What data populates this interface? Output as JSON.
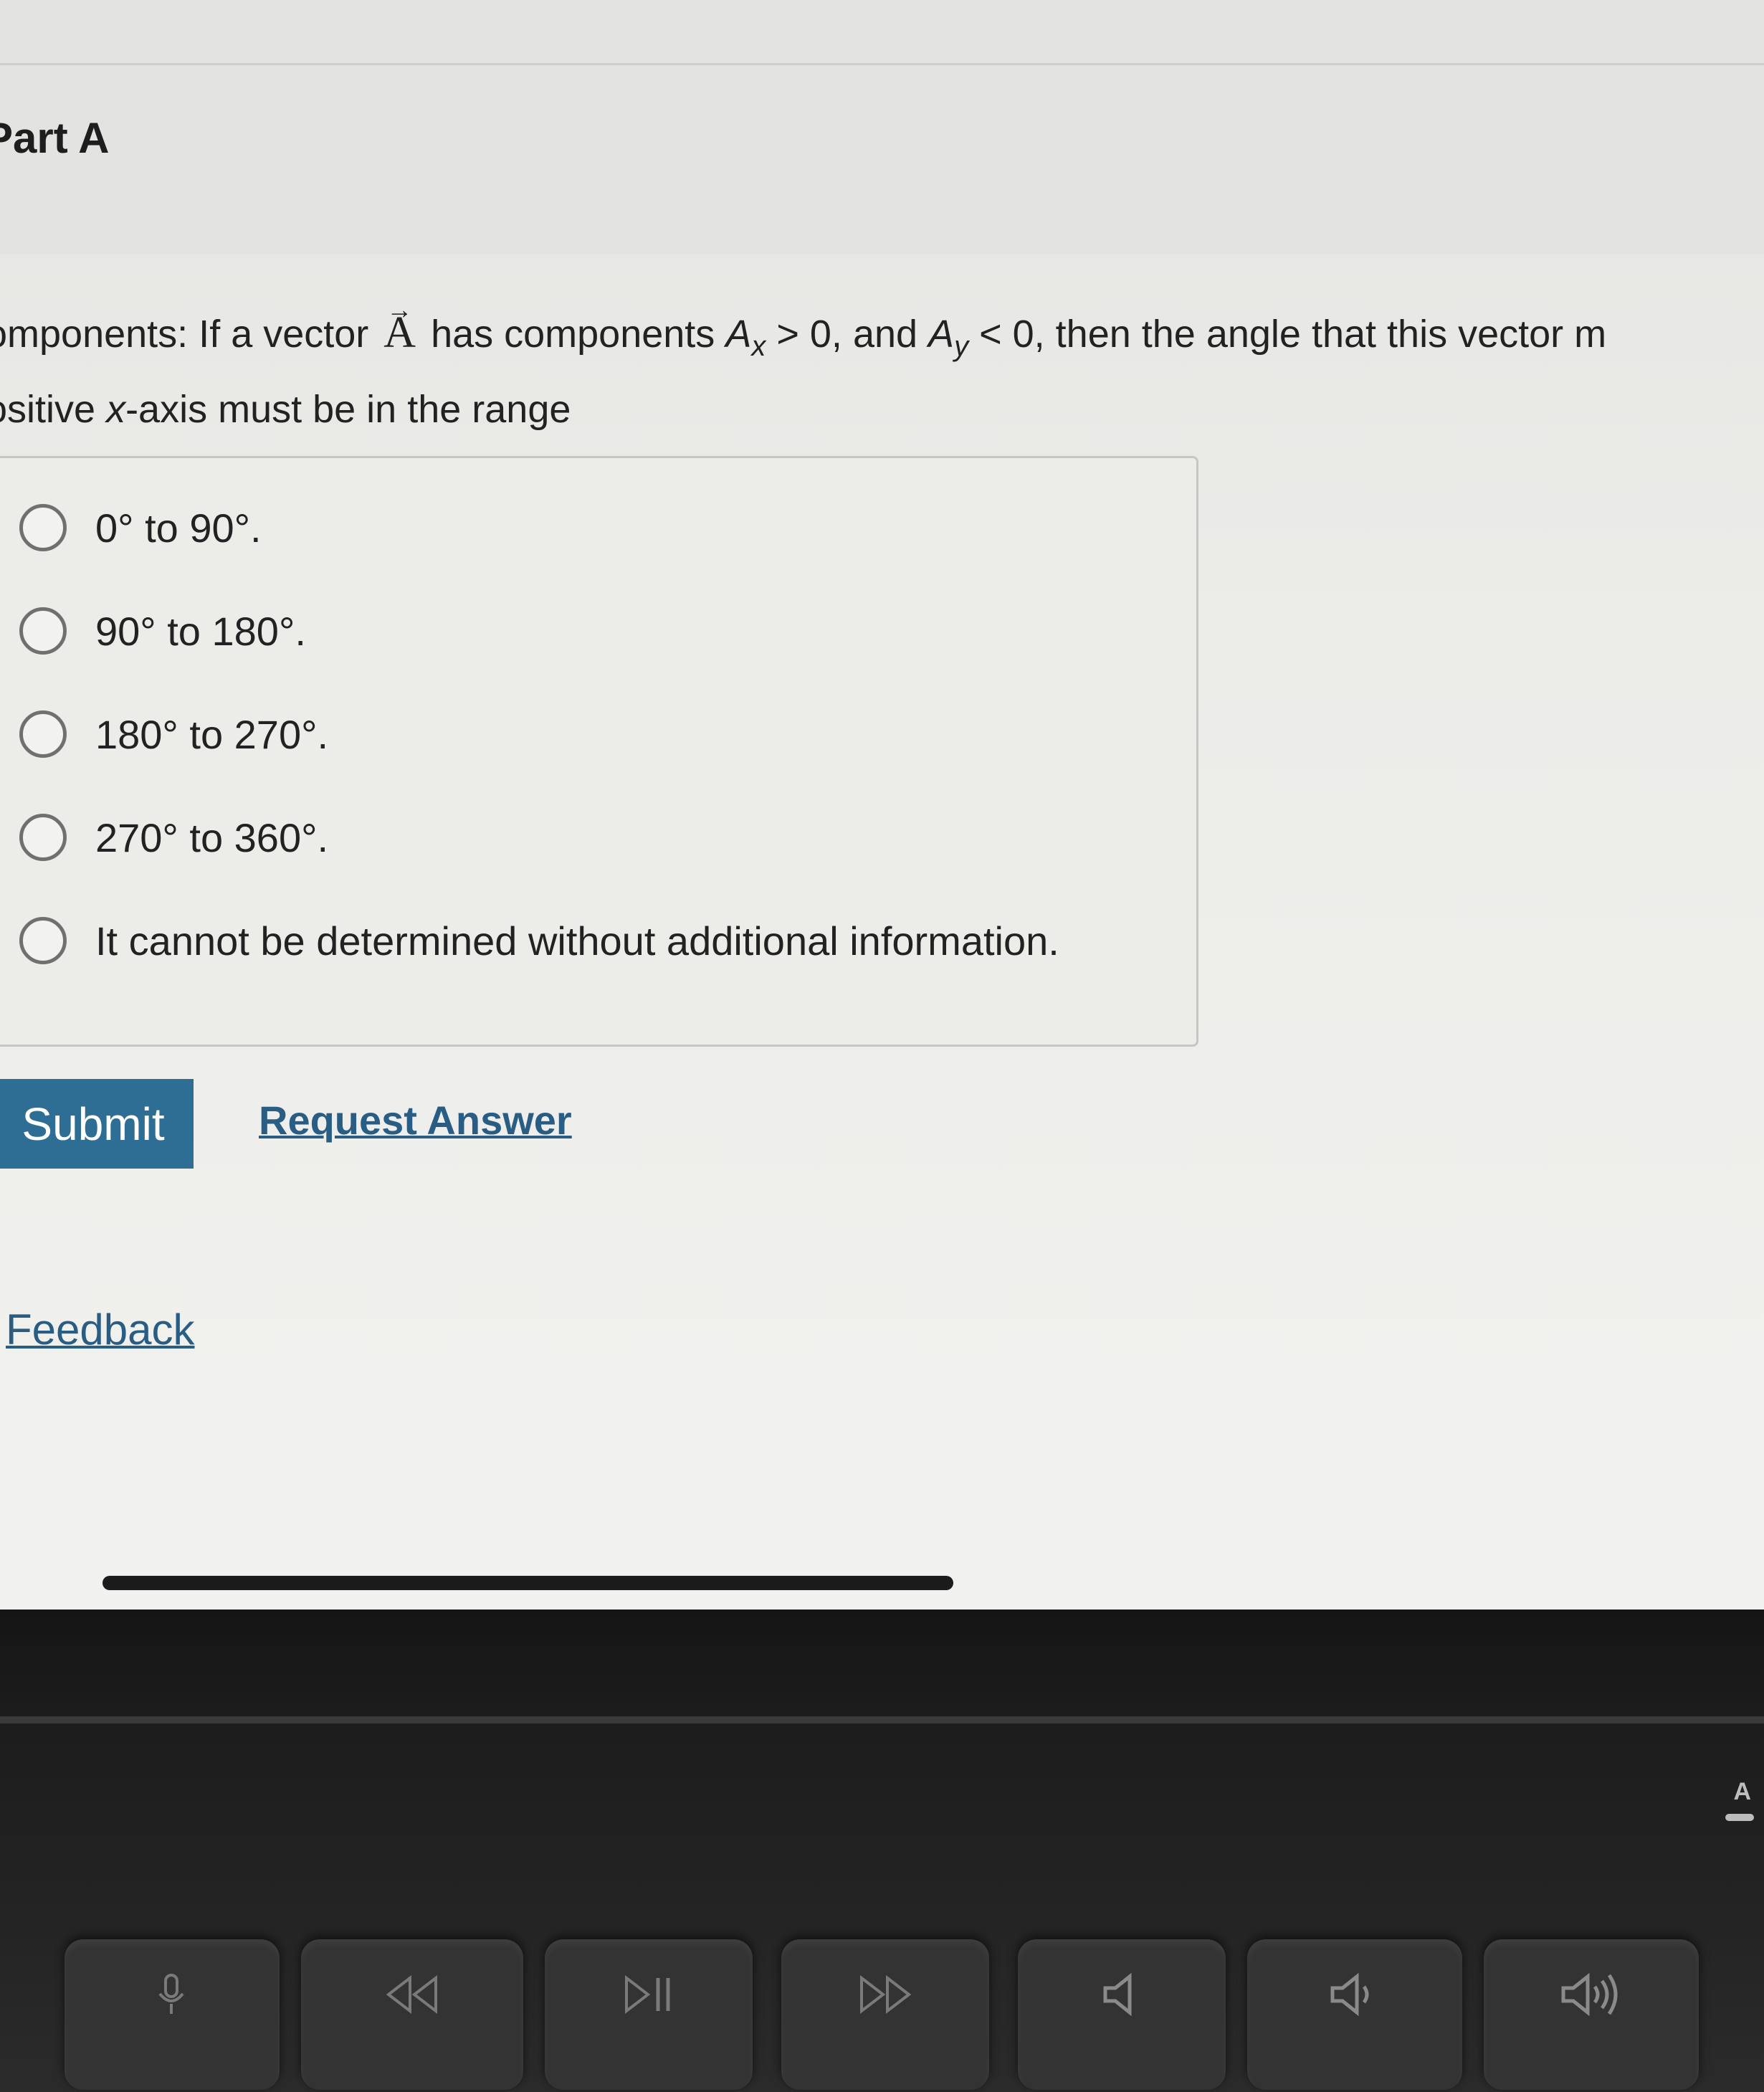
{
  "part": {
    "title": "Part A"
  },
  "question": {
    "line1": {
      "lead": "omponents: If a vector ",
      "vector": "A",
      "mid": " has components ",
      "ax": "A",
      "ax_sub": "x",
      "ax_rest": " > 0, and ",
      "ay": "A",
      "ay_sub": "y",
      "ay_rest": " < 0, then the angle that this vector m"
    },
    "line2": {
      "lead": "ositive ",
      "x": "x",
      "rest": "-axis must be in the range"
    }
  },
  "options": [
    {
      "label": "0° to 90°."
    },
    {
      "label": "90° to 180°."
    },
    {
      "label": "180° to 270°."
    },
    {
      "label": "270° to 360°."
    },
    {
      "label": "It cannot be determined without additional information."
    }
  ],
  "actions": {
    "submit_label": "Submit",
    "request_answer_label": "Request Answer"
  },
  "feedback": {
    "label": "Feedback"
  },
  "keyboard": {
    "keys": [
      "microphone-icon",
      "rewind-icon",
      "play-pause-icon",
      "fast-forward-icon",
      "mute-icon",
      "volume-down-icon",
      "volume-up-icon"
    ],
    "corner_key_label": "A"
  },
  "colors": {
    "submit_bg": "#2e6e95",
    "link": "#2a5d84",
    "bezel": "#1d1d1d"
  }
}
